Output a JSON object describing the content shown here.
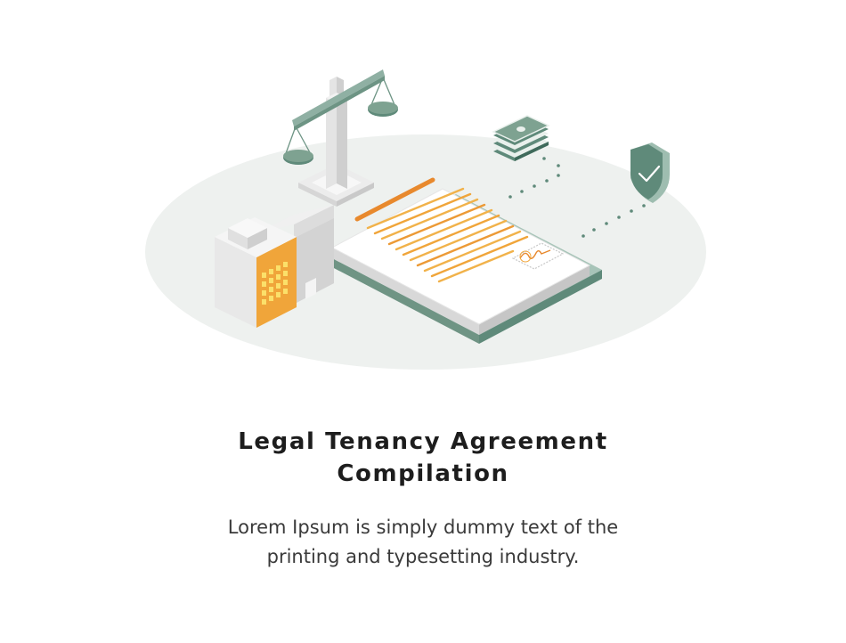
{
  "illustration": {
    "icons": [
      "scales-of-justice-icon",
      "building-icon",
      "contract-document-icon",
      "cash-stack-icon",
      "shield-check-icon",
      "signature-stamp-icon"
    ],
    "colors": {
      "platform": "#eef1ef",
      "accent_green": "#5f8a7a",
      "accent_orange": "#f0a53a",
      "document_white": "#ffffff",
      "building_gray": "#dcdcdc"
    }
  },
  "heading": {
    "line1": "Legal Tenancy Agreement",
    "line2": "Compilation"
  },
  "body": {
    "line1": "Lorem Ipsum is simply dummy text of the",
    "line2": "printing and typesetting industry."
  }
}
